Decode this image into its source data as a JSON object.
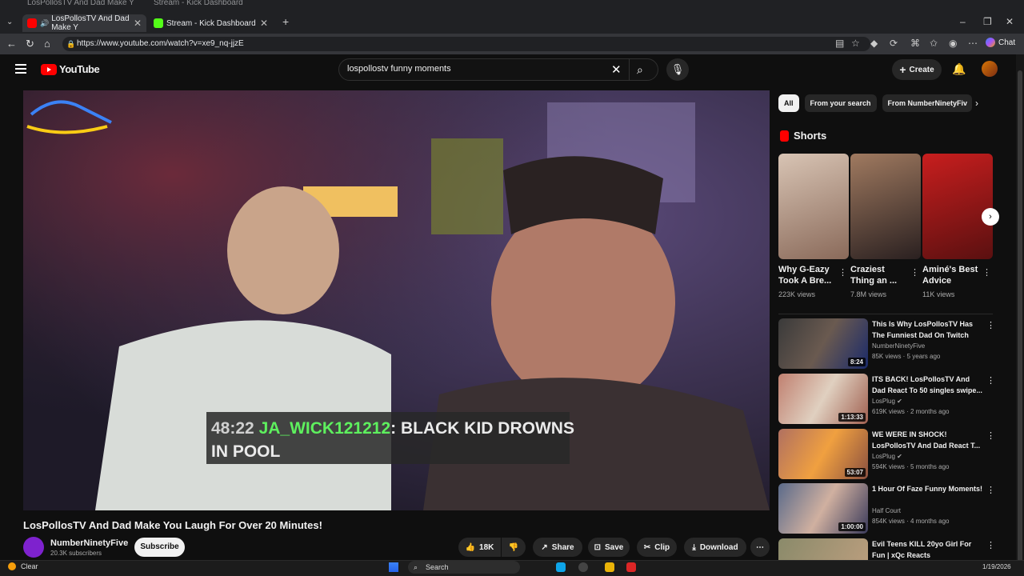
{
  "browser": {
    "tabs": [
      {
        "title": "LosPollosTV And Dad Make Y",
        "active": true
      },
      {
        "title": "Stream - Kick Dashboard",
        "active": false
      }
    ],
    "url": "https://www.youtube.com/watch?v=xe9_nq-jjzE",
    "chat_label": "Chat"
  },
  "header": {
    "logo_text": "YouTube",
    "search_query": "lospollostv funny moments",
    "create_label": "Create"
  },
  "video": {
    "caption_time": "48:22",
    "caption_user": "JA_WICK121212",
    "caption_line1_rest": ": BLACK KID DROWNS",
    "caption_line2": "IN POOL",
    "title": "LosPollosTV And Dad Make You Laugh For Over 20 Minutes!",
    "channel": "NumberNinetyFive",
    "subscribers": "20.3K subscribers",
    "subscribe_label": "Subscribe",
    "likes": "18K",
    "share_label": "Share",
    "save_label": "Save",
    "clip_label": "Clip",
    "download_label": "Download"
  },
  "chips": [
    "All",
    "From your search",
    "From NumberNinetyFiv"
  ],
  "shorts": {
    "heading": "Shorts",
    "items": [
      {
        "title": "Why G-Eazy Took A Bre...",
        "views": "223K views"
      },
      {
        "title": "Craziest Thing an ...",
        "views": "7.8M views"
      },
      {
        "title": "Aminé's Best Advice",
        "views": "11K views"
      }
    ]
  },
  "recommended": [
    {
      "title": "This Is Why LosPollosTV Has The Funniest Dad On Twitch",
      "channel": "NumberNinetyFive",
      "meta": "85K views · 5 years ago",
      "duration": "8:24"
    },
    {
      "title": "ITS BACK! LosPollosTV And Dad React To 50 singles swipe...",
      "channel": "LosPlug",
      "meta": "619K views · 2 months ago",
      "duration": "1:13:33"
    },
    {
      "title": "WE WERE IN SHOCK! LosPollosTV And Dad React T...",
      "channel": "LosPlug",
      "meta": "594K views · 5 months ago",
      "duration": "53:07"
    },
    {
      "title": "1 Hour Of Fazе Funny Moments!",
      "channel": "Half Court",
      "meta": "854K views · 4 months ago",
      "duration": "1:00:00"
    },
    {
      "title": "Evil Teens KILL 20yo Girl For Fun | xQc Reacts",
      "channel": "",
      "meta": "",
      "duration": ""
    }
  ],
  "taskbar": {
    "weather": "Clear",
    "search": "Search",
    "date": "1/19/2026"
  }
}
